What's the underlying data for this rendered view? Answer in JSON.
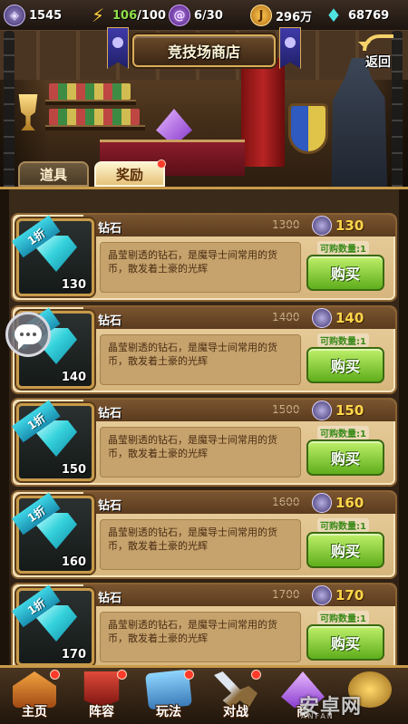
{
  "topbar": {
    "rank": {
      "icon": "rank-emblem-icon",
      "value": "1545"
    },
    "energy": {
      "icon": "lightning-icon",
      "current": "106",
      "max": "/100"
    },
    "tickets": {
      "icon": "spiral-icon",
      "value": "6/30"
    },
    "gold": {
      "icon": "gold-coin-icon",
      "glyph": "J",
      "value": "296万"
    },
    "diamonds": {
      "icon": "diamond-icon",
      "value": "68769"
    }
  },
  "header": {
    "title": "竞技场商店",
    "back_label": "返回"
  },
  "tabs": [
    {
      "label": "道具",
      "active": false
    },
    {
      "label": "奖励",
      "active": true,
      "has_alert": true
    }
  ],
  "items": [
    {
      "discount": "1折",
      "count": "130",
      "name": "钻石",
      "old_price": "1300",
      "price": "130",
      "limit": "可购数量:1",
      "desc": "晶莹剔透的钻石，是魔导士间常用的货币，散发着土豪的光辉",
      "buy_label": "购买"
    },
    {
      "discount": "1折",
      "count": "140",
      "name": "钻石",
      "old_price": "1400",
      "price": "140",
      "limit": "可购数量:1",
      "desc": "晶莹剔透的钻石，是魔导士间常用的货币，散发着土豪的光辉",
      "buy_label": "购买"
    },
    {
      "discount": "1折",
      "count": "150",
      "name": "钻石",
      "old_price": "1500",
      "price": "150",
      "limit": "可购数量:1",
      "desc": "晶莹剔透的钻石，是魔导士间常用的货币，散发着土豪的光辉",
      "buy_label": "购买"
    },
    {
      "discount": "1折",
      "count": "160",
      "name": "钻石",
      "old_price": "1600",
      "price": "160",
      "limit": "可购数量:1",
      "desc": "晶莹剔透的钻石，是魔导士间常用的货币，散发着土豪的光辉",
      "buy_label": "购买"
    },
    {
      "discount": "1折",
      "count": "170",
      "name": "钻石",
      "old_price": "1700",
      "price": "170",
      "limit": "可购数量:1",
      "desc": "晶莹剔透的钻石，是魔导士间常用的货币，散发着土豪的光辉",
      "buy_label": "购买"
    }
  ],
  "nav": [
    {
      "label": "主页",
      "icon": "home-icon",
      "has_alert": true
    },
    {
      "label": "阵容",
      "icon": "banner-icon",
      "has_alert": true
    },
    {
      "label": "玩法",
      "icon": "map-icon",
      "has_alert": true
    },
    {
      "label": "对战",
      "icon": "crossed-swords-icon",
      "has_alert": true
    },
    {
      "label": "商",
      "icon": "crystal-icon",
      "has_alert": false
    },
    {
      "label": "",
      "icon": "gear-icon",
      "has_alert": false
    }
  ],
  "watermark": {
    "text": "安卓网",
    "sub": "ANFAN"
  },
  "colors": {
    "accent_gold": "#c89a4a",
    "buy_green": "#5fae1c",
    "price_yellow": "#ffd64a",
    "energy_green": "#8ee04a"
  }
}
